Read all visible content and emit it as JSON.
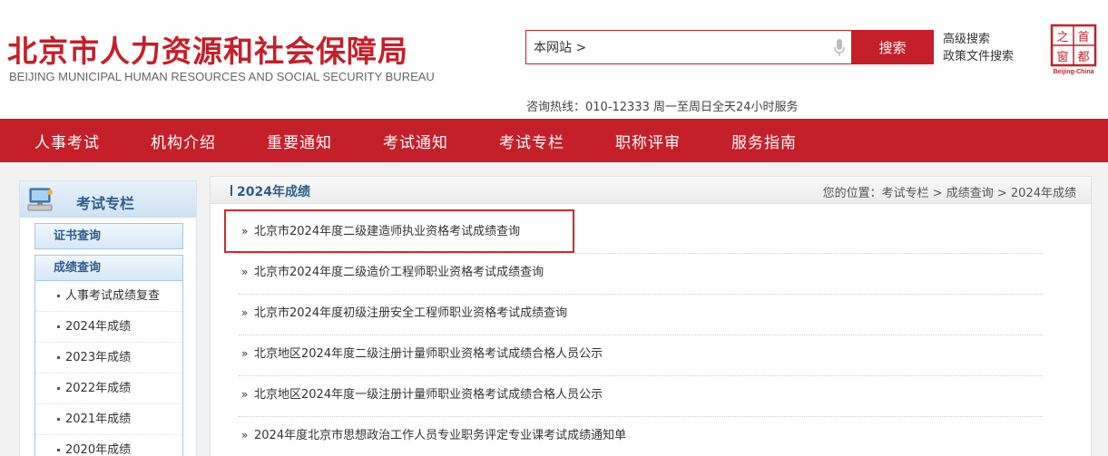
{
  "header": {
    "title_cn": "北京市人力资源和社会保障局",
    "title_en": "BEIJING MUNICIPAL HUMAN RESOURCES AND SOCIAL SECURITY BUREAU",
    "search_value": "本网站 >",
    "search_button": "搜索",
    "advanced_search": "高级搜索",
    "policy_search": "政策文件搜索",
    "hotline": "咨询热线：010-12333 周一至周日全天24小时服务",
    "seal_text": "首都之窗",
    "seal_en": "Beijing-China"
  },
  "nav": [
    "人事考试",
    "机构介绍",
    "重要通知",
    "考试通知",
    "考试专栏",
    "职称评审",
    "服务指南"
  ],
  "sidebar": {
    "title": "考试专栏",
    "categories": {
      "cert": "证书查询",
      "scores": "成绩查询"
    },
    "sub_items": [
      "人事考试成绩复查",
      "2024年成绩",
      "2023年成绩",
      "2022年成绩",
      "2021年成绩",
      "2020年成绩"
    ]
  },
  "main": {
    "section_title": "2024年成绩",
    "breadcrumb": "您的位置：考试专栏 > 成绩查询 > 2024年成绩",
    "items": [
      "北京市2024年度二级建造师执业资格考试成绩查询",
      "北京市2024年度二级造价工程师职业资格考试成绩查询",
      "北京市2024年度初级注册安全工程师职业资格考试成绩查询",
      "北京地区2024年度二级注册计量师职业资格考试成绩合格人员公示",
      "北京地区2024年度一级注册计量师职业资格考试成绩合格人员公示",
      "2024年度北京市思想政治工作人员专业职务评定专业课考试成绩通知单"
    ]
  },
  "colors": {
    "brand_red": "#c51f2a",
    "sidebar_blue": "#2c5d8f",
    "highlight_red": "#d22a2a"
  }
}
